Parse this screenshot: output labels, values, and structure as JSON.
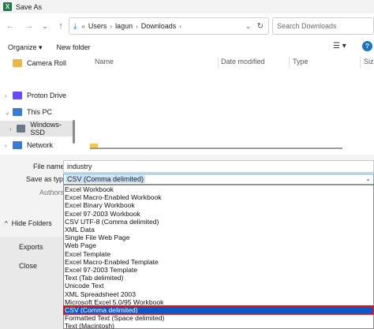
{
  "window": {
    "title": "Save As",
    "app_icon": "X"
  },
  "nav": {
    "back": "←",
    "forward": "→",
    "dropdown": "⌄",
    "up": "↑",
    "breadcrumb": [
      "«",
      "Users",
      "lagun",
      "Downloads"
    ],
    "refresh": "↻",
    "search_placeholder": "Search Downloads"
  },
  "toolbar": {
    "organize": "Organize ▾",
    "new_folder": "New folder"
  },
  "sidebar": {
    "items": [
      {
        "label": "Camera Roll",
        "color": "#e8b84a"
      },
      {
        "label": "Proton Drive",
        "color": "#6d4aff"
      },
      {
        "label": "This PC",
        "color": "#3a7bd5"
      },
      {
        "label": "Windows-SSD",
        "color": "#6b7785"
      },
      {
        "label": "Network",
        "color": "#3a7bd5"
      }
    ]
  },
  "columns": [
    "Name",
    "Date modified",
    "Type",
    "Size"
  ],
  "form": {
    "file_name_label": "File name:",
    "file_name_value": "industry",
    "save_type_label": "Save as type:",
    "save_type_value": "CSV (Comma delimited)",
    "authors_label": "Authors:",
    "hide_folders": "Hide Folders"
  },
  "backstage": {
    "exports": "Exports",
    "close": "Close"
  },
  "file_types": [
    "Excel Workbook",
    "Excel Macro-Enabled Workbook",
    "Excel Binary Workbook",
    "Excel 97-2003 Workbook",
    "CSV UTF-8 (Comma delimited)",
    "XML Data",
    "Single File Web Page",
    "Web Page",
    "Excel Template",
    "Excel Macro-Enabled Template",
    "Excel 97-2003 Template",
    "Text (Tab delimited)",
    "Unicode Text",
    "XML Spreadsheet 2003",
    "Microsoft Excel 5.0/95 Workbook",
    "CSV (Comma delimited)",
    "Formatted Text (Space delimited)",
    "Text (Macintosh)"
  ],
  "selected_type_index": 15,
  "colors": {
    "selection": "#0a58ca",
    "highlight_border": "#d71920"
  }
}
